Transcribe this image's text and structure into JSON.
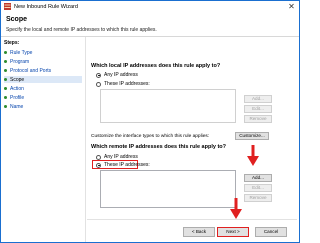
{
  "window": {
    "title": "New Inbound Rule Wizard",
    "close_glyph": "✕"
  },
  "header": {
    "title": "Scope",
    "subtitle": "Specify the local and remote IP addresses to which this rule applies."
  },
  "steps": {
    "title": "Steps:",
    "items": [
      {
        "label": "Rule Type"
      },
      {
        "label": "Program"
      },
      {
        "label": "Protocol and Ports"
      },
      {
        "label": "Scope"
      },
      {
        "label": "Action"
      },
      {
        "label": "Profile"
      },
      {
        "label": "Name"
      }
    ],
    "current_index": 3
  },
  "local": {
    "question": "Which local IP addresses does this rule apply to?",
    "any_label": "Any IP address",
    "these_label": "These IP addresses:",
    "selected": "any",
    "buttons": {
      "add": "Add...",
      "edit": "Edit...",
      "remove": "Remove"
    }
  },
  "customize": {
    "text": "Customize the interface types to which this rule applies:",
    "button": "Customize..."
  },
  "remote": {
    "question": "Which remote IP addresses does this rule apply to?",
    "any_label": "Any IP address",
    "these_label": "These IP addresses:",
    "selected": "these",
    "buttons": {
      "add": "Add...",
      "edit": "Edit...",
      "remove": "Remove"
    }
  },
  "footer": {
    "back": "< Back",
    "next": "Next >",
    "cancel": "Cancel"
  },
  "colors": {
    "annotation": "#e02020",
    "step_link": "#0645ad",
    "step_dot": "#2e8b2e",
    "accent_border": "#1a6fd0"
  },
  "icons": {
    "app": "firewall-wizard-icon",
    "close": "close-icon",
    "step": "step-bullet-icon",
    "annotation": "red-arrow-icon"
  }
}
